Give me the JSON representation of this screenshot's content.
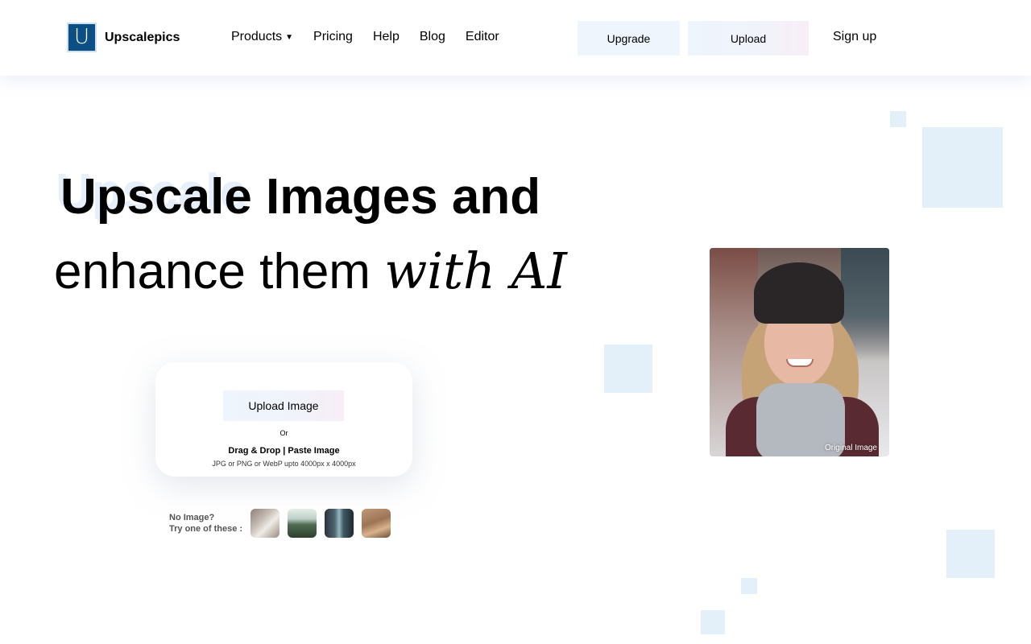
{
  "brand": {
    "logo_letter": "U",
    "name": "Upscalepics",
    "color": "#0b4f85"
  },
  "nav": {
    "items": [
      {
        "label": "Products",
        "has_dropdown": true,
        "caret": "▼"
      },
      {
        "label": "Pricing"
      },
      {
        "label": "Help"
      },
      {
        "label": "Blog"
      },
      {
        "label": "Editor"
      }
    ]
  },
  "header_actions": {
    "upgrade_label": "Upgrade",
    "upload_label": "Upload",
    "signup_label": "Sign up"
  },
  "hero": {
    "bold_word": "Upscale",
    "line1_rest": " Images and",
    "line2_plain": "enhance them ",
    "line2_script": "with AI"
  },
  "upload_card": {
    "button_label": "Upload Image",
    "or_text": "Or",
    "drag_text": "Drag & Drop | Paste Image",
    "formats_text": "JPG or PNG or WebP upto 4000px x 4000px"
  },
  "samples": {
    "line1": "No Image?",
    "line2": "Try one of these :",
    "thumbnails": [
      "cat",
      "lake",
      "street",
      "desk"
    ]
  },
  "preview": {
    "caption": "Original Image"
  },
  "colors": {
    "accent_light": "#e3eff9",
    "button_bg": "#eef5fc"
  }
}
